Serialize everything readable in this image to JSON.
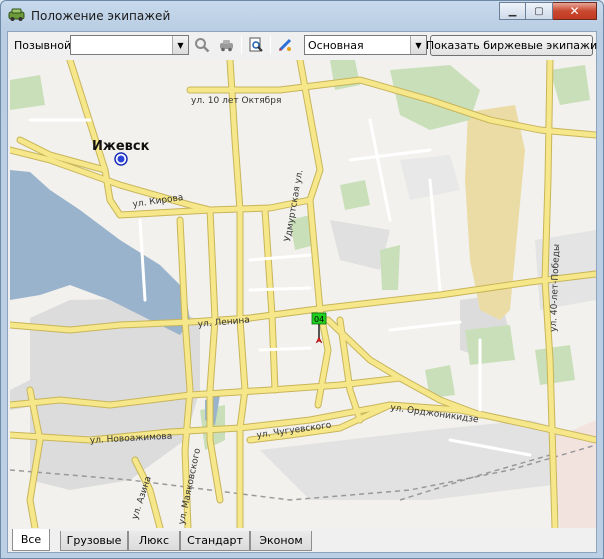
{
  "window": {
    "title": "Положение экипажей"
  },
  "toolbar": {
    "callsign_label": "Позывной:",
    "callsign_value": "",
    "layer_value": "Основная",
    "show_exchange_button": "Показать биржевые экипажи"
  },
  "map": {
    "city_label": "Ижевск",
    "streets": {
      "oktyabrya": "ул. 10 лет Октября",
      "kirova": "ул. Кирова",
      "udmurtskaya": "Удмуртская ул.",
      "lenina": "ул. Ленина",
      "pobedy": "ул. 40-лет-Победы",
      "ordzhonikidze": "ул. Орджоникидзе",
      "chugaevskogo": "ул. Чугуевского",
      "novoazhimova": "ул. Новоажимова",
      "azina": "ул. Азина",
      "mayakovskogo": "ул. Маяковского"
    },
    "vehicle": {
      "label": "04",
      "color": "#1fd11f"
    },
    "colors": {
      "water": "#99b3cc",
      "road": "#f6e78a",
      "park": "#c9dfb9",
      "industrial": "#dcdcdc",
      "sand": "#eadca4"
    }
  },
  "tabs": [
    "Все",
    "Грузовые",
    "Люкс",
    "Стандарт",
    "Эконом"
  ]
}
